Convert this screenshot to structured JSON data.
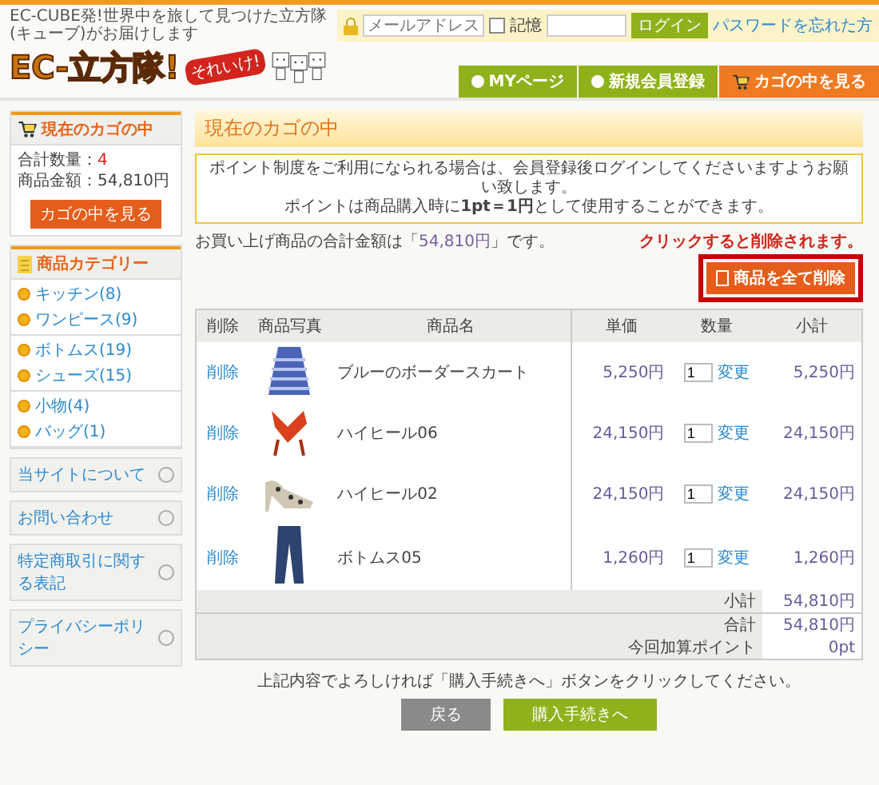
{
  "header": {
    "tagline": "EC-CUBE発!世界中を旅して見つけた立方隊(キューブ)がお届けします",
    "logo": {
      "text": "EC-立方隊!",
      "badge": "それいけ!"
    },
    "login": {
      "email_placeholder": "メールアドレス",
      "remember_checked": false,
      "remember_label": "記憶",
      "login_button": "ログイン",
      "forgot_link": "パスワードを忘れた方"
    },
    "nav": [
      {
        "label": "MYページ",
        "kind": "page",
        "selected": false
      },
      {
        "label": "新規会員登録",
        "kind": "page",
        "selected": false
      },
      {
        "label": "カゴの中を見る",
        "kind": "cart",
        "selected": true
      }
    ]
  },
  "sidebar": {
    "cart": {
      "title": "現在のカゴの中",
      "quantity_label": "合計数量：",
      "quantity": "4",
      "amount": "商品金額：54,810円",
      "button": "カゴの中を見る"
    },
    "categories": {
      "title": "商品カテゴリー",
      "groups": [
        [
          {
            "label": "キッチン(8)"
          },
          {
            "label": "ワンピース(9)"
          }
        ],
        [
          {
            "label": "ボトムス(19)"
          },
          {
            "label": "シューズ(15)"
          }
        ],
        [
          {
            "label": "小物(4)"
          },
          {
            "label": "バッグ(1)"
          }
        ]
      ]
    },
    "links": [
      "当サイトについて",
      "お問い合わせ",
      "特定商取引に関する表記",
      "プライバシーポリシー"
    ]
  },
  "main": {
    "title": "現在のカゴの中",
    "notice": [
      "ポイント制度をご利用になられる場合は、会員登録後ログインしてくださいますようお願い致します。",
      "ポイントは商品購入時に**1pt＝1円**として使用することができます。"
    ],
    "total_sentence": "お買い上げ商品の合計金額は「**54,810円**」です。",
    "annotation": "クリックすると削除されます。",
    "delete_all_button": "商品を全て削除",
    "table": {
      "columns": [
        "削除",
        "商品写真",
        "商品名",
        "単価",
        "数量",
        "小計"
      ],
      "rows": [
        {
          "delete": "削除",
          "kind": "skirt",
          "name": "ブルーのボーダースカート",
          "price": "5,250円",
          "quantity": "1",
          "change": "変更",
          "subtotal": "5,250円"
        },
        {
          "delete": "削除",
          "kind": "red-heel",
          "name": "ハイヒール06",
          "price": "24,150円",
          "quantity": "1",
          "change": "変更",
          "subtotal": "24,150円"
        },
        {
          "delete": "削除",
          "kind": "leopard-heel",
          "name": "ハイヒール02",
          "price": "24,150円",
          "quantity": "1",
          "change": "変更",
          "subtotal": "24,150円"
        },
        {
          "delete": "削除",
          "kind": "jeans",
          "name": "ボトムス05",
          "price": "1,260円",
          "quantity": "1",
          "change": "変更",
          "subtotal": "1,260円"
        }
      ],
      "summary": [
        {
          "label": "小計",
          "value": "54,810円"
        },
        {
          "label": "合計",
          "value": "54,810円"
        },
        {
          "label": "今回加算ポイント",
          "value": "0pt"
        }
      ]
    },
    "instruction": "上記内容でよろしければ「購入手続きへ」ボタンをクリックしてください。",
    "buttons": [
      {
        "label": "戻る",
        "kind": "back"
      },
      {
        "label": "購入手続きへ",
        "kind": "next"
      }
    ]
  }
}
